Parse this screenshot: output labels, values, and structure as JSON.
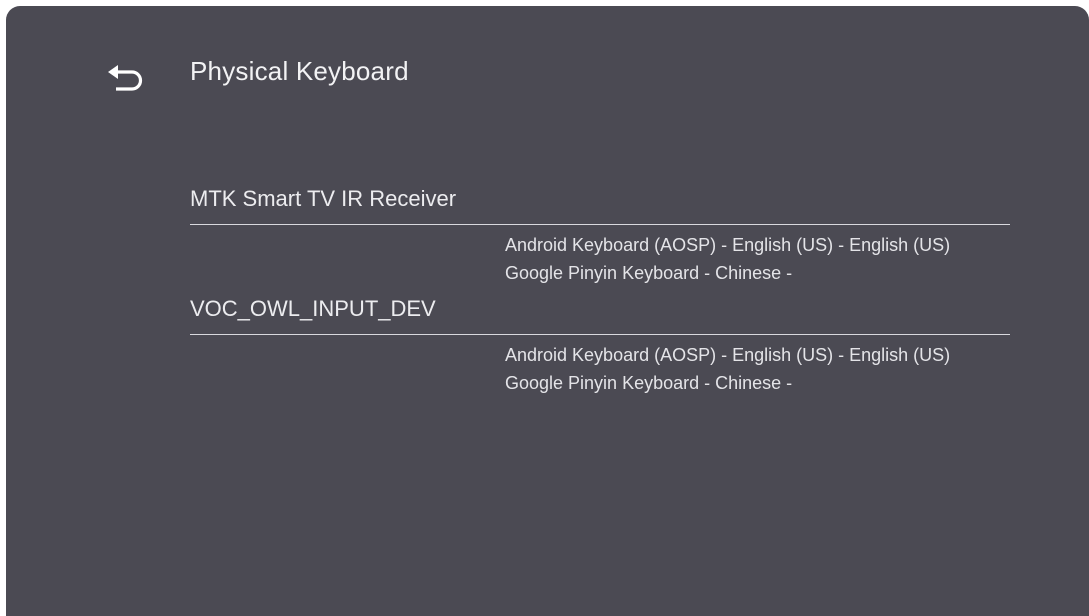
{
  "header": {
    "title": "Physical Keyboard",
    "back_icon": "back-arrow-icon"
  },
  "devices": [
    {
      "name": "MTK Smart TV IR Receiver",
      "layouts": [
        "Android Keyboard (AOSP) - English (US) - English (US)",
        "Google Pinyin Keyboard - Chinese -"
      ]
    },
    {
      "name": "VOC_OWL_INPUT_DEV",
      "layouts": [
        "Android Keyboard (AOSP) - English (US) - English (US)",
        "Google Pinyin Keyboard - Chinese -"
      ]
    }
  ],
  "colors": {
    "panel_background": "#4b4a53",
    "text": "#f2f2f4",
    "divider": "#d9d9de"
  }
}
